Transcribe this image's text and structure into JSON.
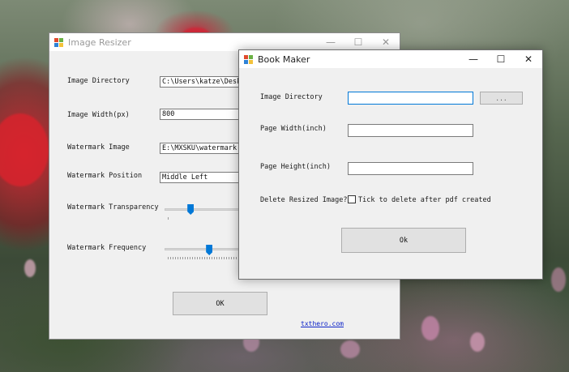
{
  "resizer": {
    "title": "Image Resizer",
    "controls": {
      "minimize": "—",
      "maximize": "☐",
      "close": "✕"
    },
    "labels": {
      "image_directory": "Image Directory",
      "image_width": "Image Width(px)",
      "watermark_image": "Watermark Image",
      "watermark_position": "Watermark Position",
      "watermark_transparency": "Watermark Transparency",
      "watermark_frequency": "Watermark Frequency"
    },
    "fields": {
      "image_directory": "C:\\Users\\katze\\Desktop",
      "image_width": "800",
      "watermark_image": "E:\\MXSKU\\watermark.jpg",
      "watermark_position": "Middle Left"
    },
    "sliders": {
      "transparency": 0.35,
      "frequency": 0.6
    },
    "ok_label": "OK",
    "link_text": "txthero.com"
  },
  "book_maker": {
    "title": "Book Maker",
    "controls": {
      "minimize": "—",
      "maximize": "☐",
      "close": "✕"
    },
    "labels": {
      "image_directory": "Image Directory",
      "page_width": "Page Width(inch)",
      "page_height": "Page Height(inch)",
      "delete_resized": "Delete Resized Image?"
    },
    "fields": {
      "image_directory": "",
      "page_width": "",
      "page_height": ""
    },
    "browse_label": "...",
    "checkbox_label": "Tick to delete after pdf created",
    "checkbox_checked": false,
    "ok_label": "Ok"
  },
  "colors": {
    "accent": "#0078d7",
    "link": "#0b22c8",
    "window_bg": "#f0f0f0"
  }
}
